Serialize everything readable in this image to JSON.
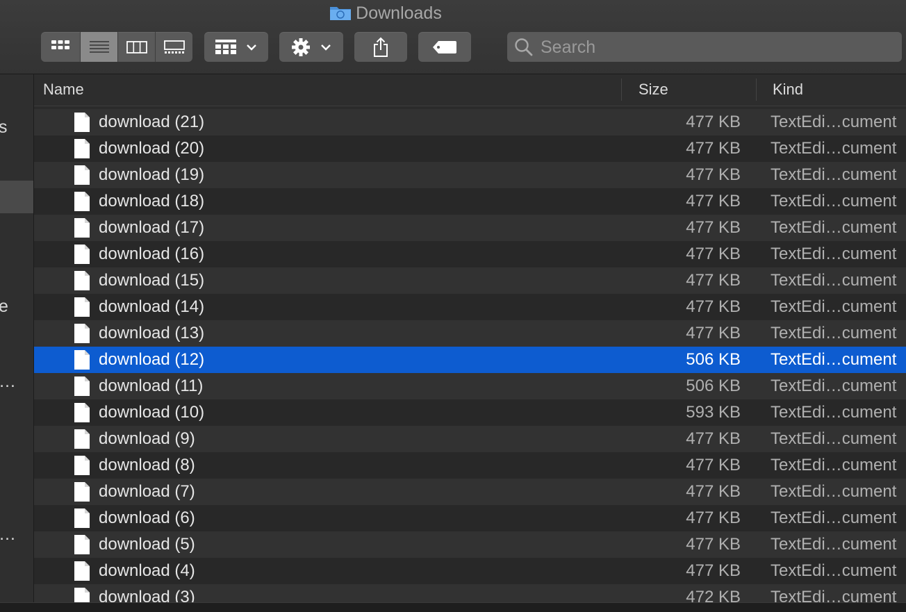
{
  "window": {
    "title": "Downloads",
    "title_icon": "folder-icon"
  },
  "toolbar": {
    "view_modes": [
      {
        "icon": "icon-view-icon",
        "selected": false
      },
      {
        "icon": "list-view-icon",
        "selected": true
      },
      {
        "icon": "column-view-icon",
        "selected": false
      },
      {
        "icon": "gallery-view-icon",
        "selected": false
      }
    ],
    "group_button_icon": "group-by-icon",
    "action_button_icon": "gear-icon",
    "share_button_icon": "share-icon",
    "tag_button_icon": "tag-icon"
  },
  "search": {
    "placeholder": "Search",
    "value": ""
  },
  "sidebar": {
    "fragments": [
      "s",
      "e",
      "…",
      "…"
    ]
  },
  "columns": {
    "name": "Name",
    "size": "Size",
    "kind": "Kind"
  },
  "colors": {
    "selection": "#0d5cd0",
    "row_odd": "#323232",
    "row_even": "#282828"
  },
  "files": [
    {
      "name": "download (21)",
      "size": "477 KB",
      "kind": "TextEdi…cument"
    },
    {
      "name": "download (20)",
      "size": "477 KB",
      "kind": "TextEdi…cument"
    },
    {
      "name": "download (19)",
      "size": "477 KB",
      "kind": "TextEdi…cument"
    },
    {
      "name": "download (18)",
      "size": "477 KB",
      "kind": "TextEdi…cument"
    },
    {
      "name": "download (17)",
      "size": "477 KB",
      "kind": "TextEdi…cument"
    },
    {
      "name": "download (16)",
      "size": "477 KB",
      "kind": "TextEdi…cument"
    },
    {
      "name": "download (15)",
      "size": "477 KB",
      "kind": "TextEdi…cument"
    },
    {
      "name": "download (14)",
      "size": "477 KB",
      "kind": "TextEdi…cument"
    },
    {
      "name": "download (13)",
      "size": "477 KB",
      "kind": "TextEdi…cument"
    },
    {
      "name": "download (12)",
      "size": "506 KB",
      "kind": "TextEdi…cument",
      "selected": true
    },
    {
      "name": "download (11)",
      "size": "506 KB",
      "kind": "TextEdi…cument"
    },
    {
      "name": "download (10)",
      "size": "593 KB",
      "kind": "TextEdi…cument"
    },
    {
      "name": "download (9)",
      "size": "477 KB",
      "kind": "TextEdi…cument"
    },
    {
      "name": "download (8)",
      "size": "477 KB",
      "kind": "TextEdi…cument"
    },
    {
      "name": "download (7)",
      "size": "477 KB",
      "kind": "TextEdi…cument"
    },
    {
      "name": "download (6)",
      "size": "477 KB",
      "kind": "TextEdi…cument"
    },
    {
      "name": "download (5)",
      "size": "477 KB",
      "kind": "TextEdi…cument"
    },
    {
      "name": "download (4)",
      "size": "477 KB",
      "kind": "TextEdi…cument"
    },
    {
      "name": "download (3)",
      "size": "472 KB",
      "kind": "TextEdi…cument"
    }
  ]
}
